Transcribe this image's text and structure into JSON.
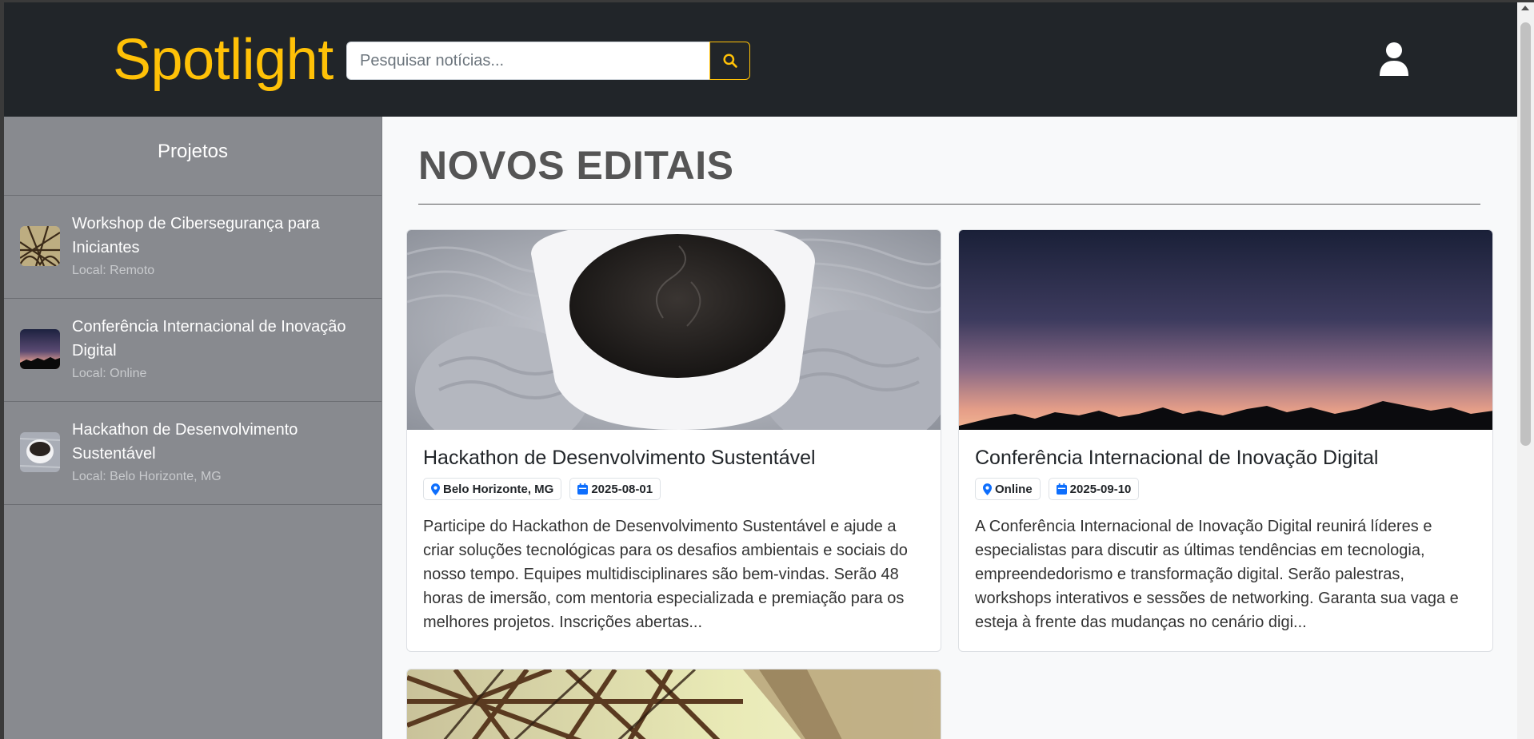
{
  "header": {
    "brand": "Spotlight",
    "search_placeholder": "Pesquisar notícias...",
    "search_icon": "search-icon",
    "user_icon": "user-icon",
    "accent_color": "#ffc107",
    "background_color": "#212529"
  },
  "sidebar": {
    "title": "Projetos",
    "items": [
      {
        "name": "Workshop de Cibersegurança para Iniciantes",
        "local": "Local: Remoto",
        "thumb": "steel-structure-image"
      },
      {
        "name": "Conferência Internacional de Inovação Digital",
        "local": "Local: Online",
        "thumb": "sunset-mountains-image"
      },
      {
        "name": "Hackathon de Desenvolvimento Sustentável",
        "local": "Local: Belo Horizonte, MG",
        "thumb": "coffee-cup-image"
      }
    ]
  },
  "main": {
    "title": "NOVOS EDITAIS",
    "cards": [
      {
        "title": "Hackathon de Desenvolvimento Sustentável",
        "location": "Belo Horizonte, MG",
        "date": "2025-08-01",
        "description": "Participe do Hackathon de Desenvolvimento Sustentável e ajude a criar soluções tecnológicas para os desafios ambientais e sociais do nosso tempo. Equipes multidisciplinares são bem-vindas. Serão 48 horas de imersão, com mentoria especializada e premiação para os melhores projetos. Inscrições abertas...",
        "image": "coffee-cup-image"
      },
      {
        "title": "Conferência Internacional de Inovação Digital",
        "location": "Online",
        "date": "2025-09-10",
        "description": "A Conferência Internacional de Inovação Digital reunirá líderes e especialistas para discutir as últimas tendências em tecnologia, empreendedorismo e transformação digital. Serão palestras, workshops interativos e sessões de networking. Garanta sua vaga e esteja à frente das mudanças no cenário digi...",
        "image": "sunset-mountains-image"
      },
      {
        "image": "steel-structure-image"
      }
    ],
    "badge_icon_color": "#0d6efd"
  }
}
